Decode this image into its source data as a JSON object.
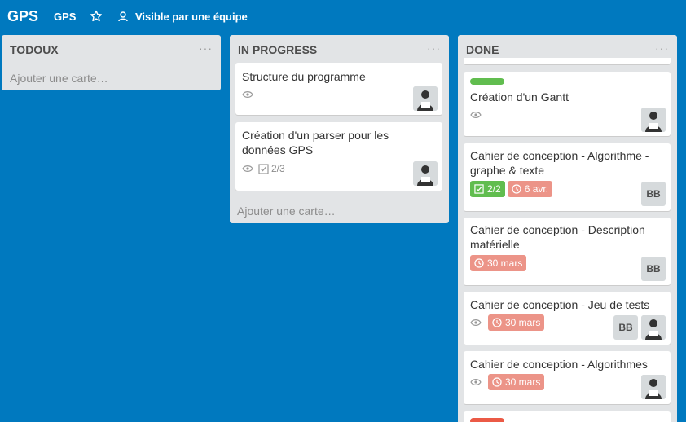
{
  "header": {
    "logo": "GPS",
    "board_name": "GPS",
    "visibility": "Visible par une équipe"
  },
  "lists": {
    "todoux": {
      "title": "TODOUX",
      "menu": "···",
      "add_card": "Ajouter une carte…"
    },
    "in_progress": {
      "title": "IN PROGRESS",
      "menu": "···",
      "add_card": "Ajouter une carte…",
      "cards": [
        {
          "title": "Structure du programme"
        },
        {
          "title": "Création d'un parser pour les données GPS",
          "checklist": "2/3"
        }
      ]
    },
    "done": {
      "title": "DONE",
      "menu": "···",
      "cards": [
        {
          "title": "Création d'un Gantt"
        },
        {
          "title": "Cahier de conception - Algorithme - graphe & texte",
          "checklist": "2/2",
          "due": "6 avr.",
          "member": "BB"
        },
        {
          "title": "Cahier de conception - Description matérielle",
          "due": "30 mars",
          "member": "BB"
        },
        {
          "title": "Cahier de conception - Jeu de tests",
          "due": "30 mars",
          "member": "BB"
        },
        {
          "title": "Cahier de conception - Algorithmes",
          "due": "30 mars"
        }
      ]
    }
  },
  "colors": {
    "board_bg": "#0079bf",
    "list_bg": "#e2e4e6",
    "label_green": "#61bd4f",
    "due_red": "#ec9488",
    "label_red": "#eb5a46"
  }
}
